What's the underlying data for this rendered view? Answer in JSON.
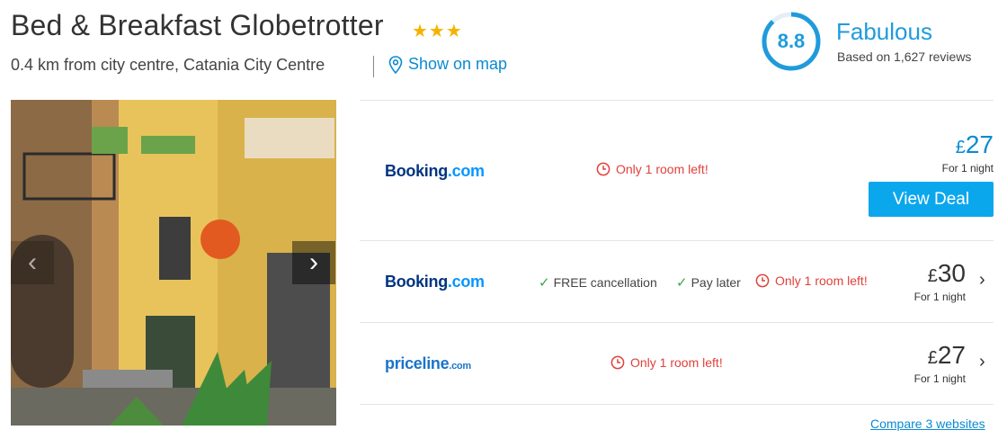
{
  "hotel": {
    "name": "Bed & Breakfast Globetrotter",
    "stars": 3,
    "stars_glyph": "★★★",
    "location": "0.4 km from city centre, Catania City Centre",
    "show_on_map": "Show on map"
  },
  "rating": {
    "score": "8.8",
    "score_fraction": 0.88,
    "label": "Fabulous",
    "reviews": "Based on 1,627 reviews",
    "accent": "#1f9bdc"
  },
  "gallery": {
    "prev_icon": "‹",
    "next_icon": "›"
  },
  "deals": [
    {
      "provider_part1": "Booking",
      "provider_part2": ".com",
      "urgency": "Only 1 room left!",
      "currency": "£",
      "price": "27",
      "per": "For 1 night",
      "button": "View Deal",
      "price_color": "#0a8ad2"
    },
    {
      "provider_part1": "Booking",
      "provider_part2": ".com",
      "features": [
        "FREE cancellation",
        "Pay later"
      ],
      "urgency": "Only 1 room left!",
      "currency": "£",
      "price": "30",
      "per": "For 1 night",
      "price_color": "#333333"
    },
    {
      "provider_part1": "priceline",
      "provider_part2": ".com",
      "urgency": "Only 1 room left!",
      "currency": "£",
      "price": "27",
      "per": "For 1 night",
      "price_color": "#333333"
    }
  ],
  "compare_link": "Compare 3 websites",
  "colors": {
    "link": "#0a8ad2",
    "button": "#0ba7ed",
    "urgent": "#e0413a",
    "check": "#3aa64a",
    "star": "#f5b301"
  }
}
